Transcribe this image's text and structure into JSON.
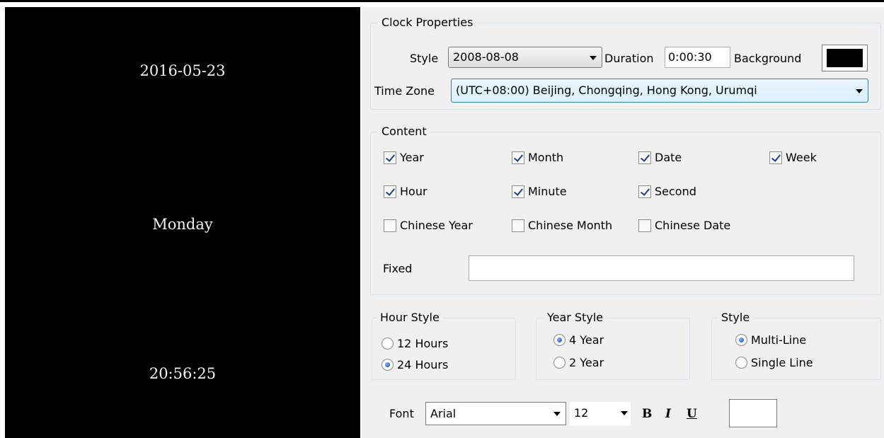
{
  "preview": {
    "date": "2016-05-23",
    "weekday": "Monday",
    "time": "20:56:25",
    "background": "#000000",
    "text_color": "#f2f2f2"
  },
  "clock_properties": {
    "title": "Clock Properties",
    "style_label": "Style",
    "style_value": "2008-08-08",
    "duration_label": "Duration",
    "duration_value": "0:00:30",
    "background_label": "Background",
    "background_color": "#000000",
    "timezone_label": "Time Zone",
    "timezone_value": "(UTC+08:00) Beijing, Chongqing, Hong Kong, Urumqi"
  },
  "content": {
    "title": "Content",
    "year": "Year",
    "month": "Month",
    "date": "Date",
    "week": "Week",
    "hour": "Hour",
    "minute": "Minute",
    "second": "Second",
    "chinese_year": "Chinese Year",
    "chinese_month": "Chinese Month",
    "chinese_date": "Chinese Date",
    "fixed_label": "Fixed",
    "fixed_value": ""
  },
  "hour_style": {
    "title": "Hour Style",
    "opt12": "12 Hours",
    "opt24": "24 Hours",
    "selected": "24 Hours"
  },
  "year_style": {
    "title": "Year Style",
    "opt4": "4 Year",
    "opt2": "2 Year",
    "selected": "4 Year"
  },
  "line_style": {
    "title": "Style",
    "multi": "Multi-Line",
    "single": "Single Line",
    "selected": "Multi-Line"
  },
  "font": {
    "label": "Font",
    "family": "Arial",
    "size": "12",
    "bold": "B",
    "italic": "I",
    "underline": "U",
    "color": "#ffffff"
  },
  "icons": {
    "dropdown": "chevron-down-icon",
    "bold": "bold-icon",
    "italic": "italic-icon",
    "underline": "underline-icon"
  }
}
